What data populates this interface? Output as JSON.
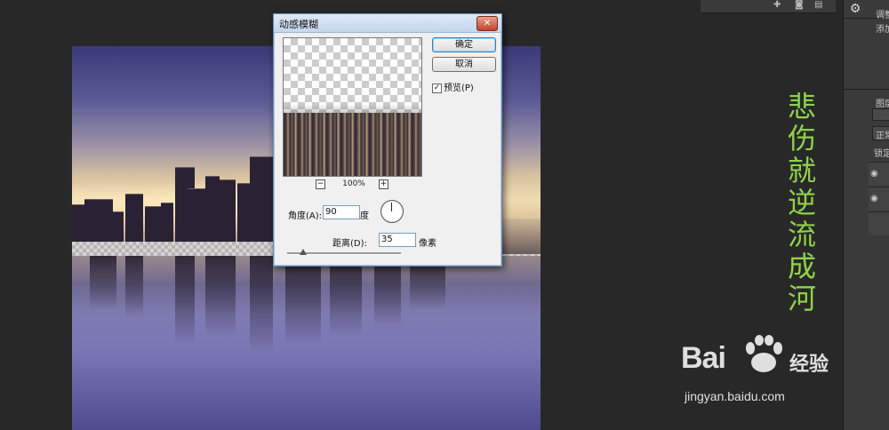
{
  "dialog": {
    "title": "动感模糊",
    "ok_label": "确定",
    "cancel_label": "取消",
    "preview_label": "预览(P)",
    "preview_checked": true,
    "zoom_minus": "−",
    "zoom_plus": "+",
    "zoom": "100%",
    "angle_label": "角度(A):",
    "angle_value": "90",
    "angle_unit": "度",
    "distance_label": "距离(D):",
    "distance_value": "35",
    "distance_unit": "像素",
    "distance_slider_fraction": 0.14
  },
  "right_panel": {
    "tab_adjust": "调整",
    "add_text": "添加",
    "layers_tab": "图层",
    "blend_mode": "正常",
    "lock_label": "锁定"
  },
  "poem": [
    "悲",
    "伤",
    "就",
    "逆",
    "流",
    "成",
    "河"
  ],
  "watermark": {
    "logo": "Bai",
    "logo_suffix": "经验",
    "url": "jingyan.baidu.com"
  },
  "colors": {
    "poem": "#8fd24a",
    "dialog_bg": "#f0f0f0",
    "workspace": "#282828"
  }
}
